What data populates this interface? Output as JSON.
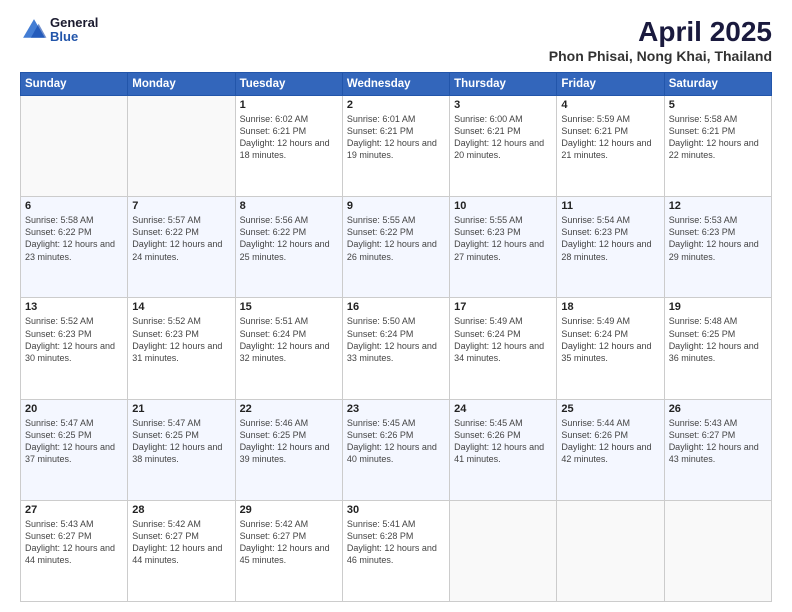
{
  "header": {
    "logo": {
      "general": "General",
      "blue": "Blue"
    },
    "title": "April 2025",
    "subtitle": "Phon Phisai, Nong Khai, Thailand"
  },
  "weekdays": [
    "Sunday",
    "Monday",
    "Tuesday",
    "Wednesday",
    "Thursday",
    "Friday",
    "Saturday"
  ],
  "weeks": [
    [
      {
        "day": "",
        "info": ""
      },
      {
        "day": "",
        "info": ""
      },
      {
        "day": "1",
        "info": "Sunrise: 6:02 AM\nSunset: 6:21 PM\nDaylight: 12 hours\nand 18 minutes."
      },
      {
        "day": "2",
        "info": "Sunrise: 6:01 AM\nSunset: 6:21 PM\nDaylight: 12 hours\nand 19 minutes."
      },
      {
        "day": "3",
        "info": "Sunrise: 6:00 AM\nSunset: 6:21 PM\nDaylight: 12 hours\nand 20 minutes."
      },
      {
        "day": "4",
        "info": "Sunrise: 5:59 AM\nSunset: 6:21 PM\nDaylight: 12 hours\nand 21 minutes."
      },
      {
        "day": "5",
        "info": "Sunrise: 5:58 AM\nSunset: 6:21 PM\nDaylight: 12 hours\nand 22 minutes."
      }
    ],
    [
      {
        "day": "6",
        "info": "Sunrise: 5:58 AM\nSunset: 6:22 PM\nDaylight: 12 hours\nand 23 minutes."
      },
      {
        "day": "7",
        "info": "Sunrise: 5:57 AM\nSunset: 6:22 PM\nDaylight: 12 hours\nand 24 minutes."
      },
      {
        "day": "8",
        "info": "Sunrise: 5:56 AM\nSunset: 6:22 PM\nDaylight: 12 hours\nand 25 minutes."
      },
      {
        "day": "9",
        "info": "Sunrise: 5:55 AM\nSunset: 6:22 PM\nDaylight: 12 hours\nand 26 minutes."
      },
      {
        "day": "10",
        "info": "Sunrise: 5:55 AM\nSunset: 6:23 PM\nDaylight: 12 hours\nand 27 minutes."
      },
      {
        "day": "11",
        "info": "Sunrise: 5:54 AM\nSunset: 6:23 PM\nDaylight: 12 hours\nand 28 minutes."
      },
      {
        "day": "12",
        "info": "Sunrise: 5:53 AM\nSunset: 6:23 PM\nDaylight: 12 hours\nand 29 minutes."
      }
    ],
    [
      {
        "day": "13",
        "info": "Sunrise: 5:52 AM\nSunset: 6:23 PM\nDaylight: 12 hours\nand 30 minutes."
      },
      {
        "day": "14",
        "info": "Sunrise: 5:52 AM\nSunset: 6:23 PM\nDaylight: 12 hours\nand 31 minutes."
      },
      {
        "day": "15",
        "info": "Sunrise: 5:51 AM\nSunset: 6:24 PM\nDaylight: 12 hours\nand 32 minutes."
      },
      {
        "day": "16",
        "info": "Sunrise: 5:50 AM\nSunset: 6:24 PM\nDaylight: 12 hours\nand 33 minutes."
      },
      {
        "day": "17",
        "info": "Sunrise: 5:49 AM\nSunset: 6:24 PM\nDaylight: 12 hours\nand 34 minutes."
      },
      {
        "day": "18",
        "info": "Sunrise: 5:49 AM\nSunset: 6:24 PM\nDaylight: 12 hours\nand 35 minutes."
      },
      {
        "day": "19",
        "info": "Sunrise: 5:48 AM\nSunset: 6:25 PM\nDaylight: 12 hours\nand 36 minutes."
      }
    ],
    [
      {
        "day": "20",
        "info": "Sunrise: 5:47 AM\nSunset: 6:25 PM\nDaylight: 12 hours\nand 37 minutes."
      },
      {
        "day": "21",
        "info": "Sunrise: 5:47 AM\nSunset: 6:25 PM\nDaylight: 12 hours\nand 38 minutes."
      },
      {
        "day": "22",
        "info": "Sunrise: 5:46 AM\nSunset: 6:25 PM\nDaylight: 12 hours\nand 39 minutes."
      },
      {
        "day": "23",
        "info": "Sunrise: 5:45 AM\nSunset: 6:26 PM\nDaylight: 12 hours\nand 40 minutes."
      },
      {
        "day": "24",
        "info": "Sunrise: 5:45 AM\nSunset: 6:26 PM\nDaylight: 12 hours\nand 41 minutes."
      },
      {
        "day": "25",
        "info": "Sunrise: 5:44 AM\nSunset: 6:26 PM\nDaylight: 12 hours\nand 42 minutes."
      },
      {
        "day": "26",
        "info": "Sunrise: 5:43 AM\nSunset: 6:27 PM\nDaylight: 12 hours\nand 43 minutes."
      }
    ],
    [
      {
        "day": "27",
        "info": "Sunrise: 5:43 AM\nSunset: 6:27 PM\nDaylight: 12 hours\nand 44 minutes."
      },
      {
        "day": "28",
        "info": "Sunrise: 5:42 AM\nSunset: 6:27 PM\nDaylight: 12 hours\nand 44 minutes."
      },
      {
        "day": "29",
        "info": "Sunrise: 5:42 AM\nSunset: 6:27 PM\nDaylight: 12 hours\nand 45 minutes."
      },
      {
        "day": "30",
        "info": "Sunrise: 5:41 AM\nSunset: 6:28 PM\nDaylight: 12 hours\nand 46 minutes."
      },
      {
        "day": "",
        "info": ""
      },
      {
        "day": "",
        "info": ""
      },
      {
        "day": "",
        "info": ""
      }
    ]
  ]
}
